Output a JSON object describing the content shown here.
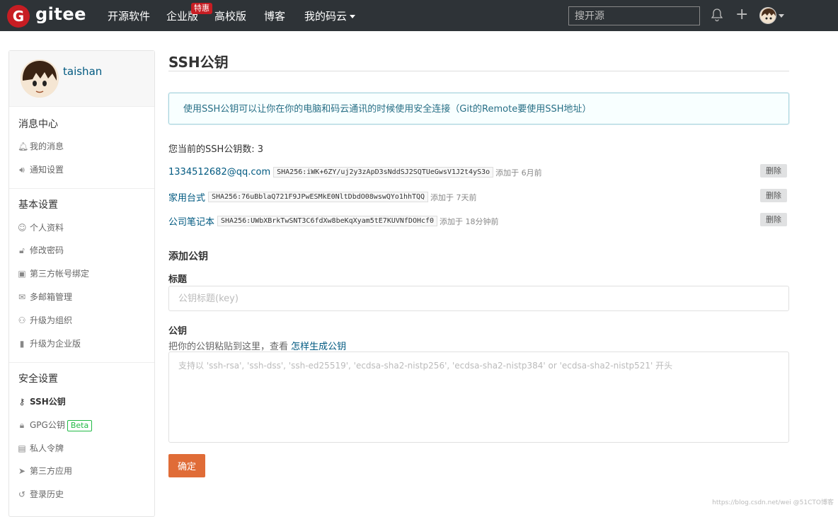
{
  "topbar": {
    "logo_letter": "G",
    "brand": "gitee",
    "nav": [
      {
        "label": "开源软件"
      },
      {
        "label": "企业版"
      },
      {
        "label": "高校版"
      },
      {
        "label": "博客"
      },
      {
        "label": "我的码云"
      }
    ],
    "hot_badge": "特惠",
    "search_placeholder": "搜开源"
  },
  "sidebar": {
    "username": "taishan",
    "sections": [
      {
        "title": "消息中心",
        "items": [
          {
            "label": "我的消息",
            "icon": "bell-icon"
          },
          {
            "label": "通知设置",
            "icon": "volume-icon"
          }
        ]
      },
      {
        "title": "基本设置",
        "items": [
          {
            "label": "个人资料",
            "icon": "user-icon"
          },
          {
            "label": "修改密码",
            "icon": "unlock-icon"
          },
          {
            "label": "第三方帐号绑定",
            "icon": "id-card-icon"
          },
          {
            "label": "多邮箱管理",
            "icon": "mail-icon"
          },
          {
            "label": "升级为组织",
            "icon": "users-icon"
          },
          {
            "label": "升级为企业版",
            "icon": "building-icon"
          }
        ]
      },
      {
        "title": "安全设置",
        "items": [
          {
            "label": "SSH公钥",
            "icon": "key-icon",
            "active": true
          },
          {
            "label": "GPG公钥",
            "icon": "lock-icon",
            "badge": "Beta"
          },
          {
            "label": "私人令牌",
            "icon": "token-icon"
          },
          {
            "label": "第三方应用",
            "icon": "rocket-icon"
          },
          {
            "label": "登录历史",
            "icon": "history-icon"
          }
        ]
      }
    ]
  },
  "main": {
    "title": "SSH公钥",
    "info": "使用SSH公钥可以让你在你的电脑和码云通讯的时候使用安全连接（Git的Remote要使用SSH地址）",
    "count_text": "您当前的SSH公钥数: 3",
    "keys": [
      {
        "title": "1334512682@qq.com",
        "fingerprint": "SHA256:iWK+6ZY/uj2y3zApD3sNddSJ2SQTUeGwsV1J2t4yS3o",
        "time": "添加于 6月前",
        "delete": "删除"
      },
      {
        "title": "家用台式",
        "fingerprint": "SHA256:76uBblaQ721F9JPwESMkE0NltDbdO08wswQYo1hhTQQ",
        "time": "添加于 7天前",
        "delete": "删除"
      },
      {
        "title": "公司笔记本",
        "fingerprint": "SHA256:UWbXBrkTwSNT3C6fdXw8beKqXyam5tE7KUVNfDOHcf0",
        "time": "添加于 18分钟前",
        "delete": "删除"
      }
    ],
    "add_title": "添加公钥",
    "title_label": "标题",
    "title_placeholder": "公钥标题(key)",
    "key_label": "公钥",
    "hint_prefix": "把你的公钥粘贴到这里，查看",
    "hint_link": "怎样生成公钥",
    "key_placeholder": "支持以 'ssh-rsa', 'ssh-dss', 'ssh-ed25519', 'ecdsa-sha2-nistp256', 'ecdsa-sha2-nistp384' or 'ecdsa-sha2-nistp521' 开头",
    "submit": "确定"
  },
  "watermark": "https://blog.csdn.net/wei @51CTO博客",
  "colors": {
    "topbar": "#2e3337",
    "brand_red": "#c71d23",
    "submit": "#e06c37",
    "link": "#005980"
  }
}
